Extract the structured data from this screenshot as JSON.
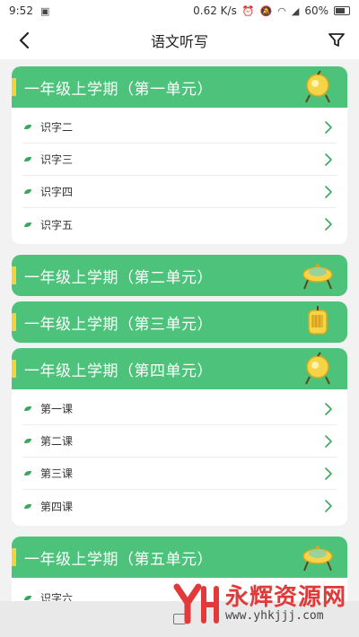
{
  "status_bar": {
    "time": "9:52",
    "network_speed": "0.62 K/s",
    "battery": "60%"
  },
  "header": {
    "title": "语文听写",
    "back_icon": "chevron-left-icon",
    "filter_icon": "filter-icon"
  },
  "units": [
    {
      "title": "一年级上学期（第一单元）",
      "expanded": true,
      "lessons": [
        "识字二",
        "识字三",
        "识字四",
        "识字五"
      ]
    },
    {
      "title": "一年级上学期（第二单元）",
      "expanded": false,
      "lessons": []
    },
    {
      "title": "一年级上学期（第三单元）",
      "expanded": false,
      "lessons": []
    },
    {
      "title": "一年级上学期（第四单元）",
      "expanded": true,
      "lessons": [
        "第一课",
        "第二课",
        "第三课",
        "第四课"
      ]
    },
    {
      "title": "一年级上学期（第五单元）",
      "expanded": true,
      "lessons": [
        "识字六"
      ]
    }
  ],
  "watermark": {
    "title": "永辉资源网",
    "url": "www.yhkjjj.com"
  },
  "colors": {
    "accent_green": "#4cc27a",
    "accent_yellow": "#f3d23a",
    "watermark_red": "#e23a3a"
  }
}
